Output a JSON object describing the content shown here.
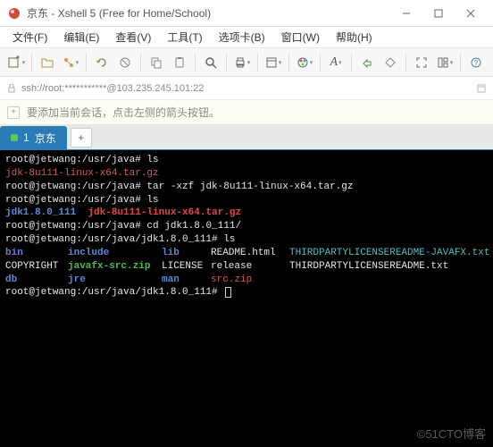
{
  "titlebar": {
    "title": "京东 - Xshell 5 (Free for Home/School)"
  },
  "menubar": {
    "items": [
      "文件(F)",
      "编辑(E)",
      "查看(V)",
      "工具(T)",
      "选项卡(B)",
      "窗口(W)",
      "帮助(H)"
    ]
  },
  "addressbar": {
    "text": "ssh://root:***********@103.235.245.101:22"
  },
  "tipbar": {
    "text": "要添加当前会话，点击左侧的箭头按钮。"
  },
  "tabs": {
    "active": {
      "index": "1",
      "label": "京东"
    }
  },
  "terminal": {
    "lines": [
      {
        "prompt": "root@jetwang:/usr/java#",
        "cmd": " ls"
      },
      {
        "red": "jdk-8u111-linux-x64.tar.gz"
      },
      {
        "prompt": "root@jetwang:/usr/java#",
        "cmd": " tar -xzf jdk-8u111-linux-x64.tar.gz"
      },
      {
        "prompt": "root@jetwang:/usr/java#",
        "cmd": " ls"
      },
      {
        "blue": "jdk1.8.0_111",
        "sep": "  ",
        "bred": "jdk-8u111-linux-x64.tar.gz"
      },
      {
        "prompt": "root@jetwang:/usr/java#",
        "cmd": " cd jdk1.8.0_111/"
      },
      {
        "prompt": "root@jetwang:/usr/java/jdk1.8.0_111#",
        "cmd": " ls"
      }
    ],
    "ls_grid": {
      "r1": {
        "c1": "bin",
        "c2": "include",
        "c3": "lib",
        "c4": "README.html",
        "c5": "THIRDPARTYLICENSEREADME-JAVAFX.txt"
      },
      "r2": {
        "c1": "COPYRIGHT",
        "c2": "javafx-src.zip",
        "c3": "LICENSE",
        "c4": "release",
        "c5": "THIRDPARTYLICENSEREADME.txt"
      },
      "r3": {
        "c1": "db",
        "c2": "jre",
        "c3": "man",
        "c4": "src.zip",
        "c5": ""
      }
    },
    "final_prompt": "root@jetwang:/usr/java/jdk1.8.0_111# "
  },
  "watermark": "©51CTO博客"
}
